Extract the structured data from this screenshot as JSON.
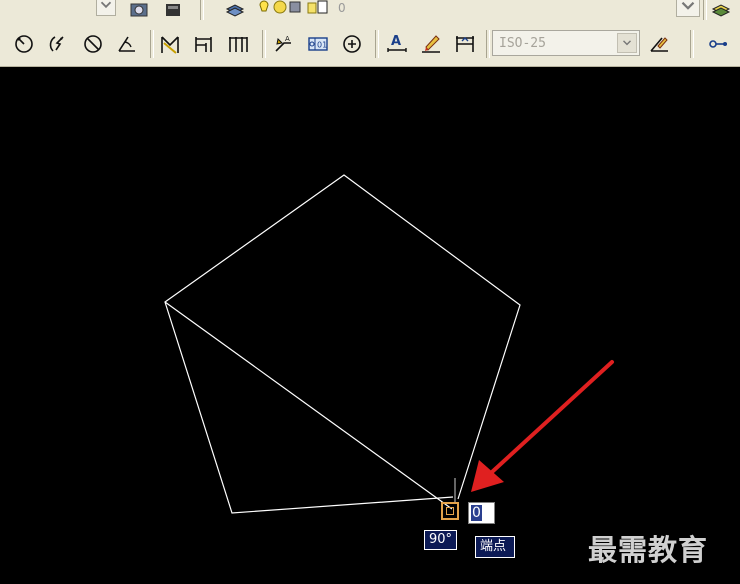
{
  "toolbar": {
    "dimension_style": "ISO-25",
    "top_hint": "0"
  },
  "canvas": {
    "angle_tooltip": "90°",
    "snap_tooltip": "端点",
    "dynamic_input_value": "0"
  },
  "watermark": "最需教育",
  "colors": {
    "canvas_background": "#000000",
    "geometry_line": "#ffffff",
    "snap_marker": "#e3a34b",
    "tooltip_background": "#0c1a55",
    "annotation_arrow": "#e02020",
    "toolbar_background": "#ece9d8"
  }
}
